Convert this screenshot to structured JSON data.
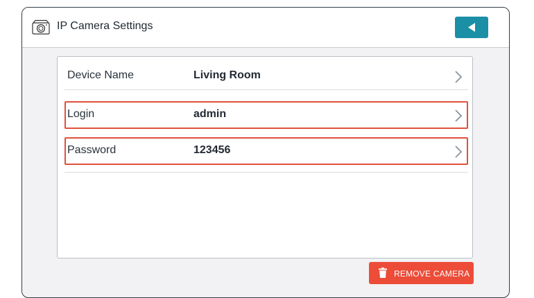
{
  "header": {
    "title": "IP Camera Settings",
    "camera_icon": "camera-icon",
    "back_icon": "back-arrow-icon",
    "accent_color": "#1a8fa6"
  },
  "settings": [
    {
      "label": "Device Name",
      "value": "Living Room",
      "highlighted": false
    },
    {
      "label": "Login",
      "value": "admin",
      "highlighted": true
    },
    {
      "label": "Password",
      "value": "123456",
      "highlighted": true
    }
  ],
  "remove_button": {
    "label": "REMOVE CAMERA",
    "icon": "trash-icon",
    "color": "#ec4c38"
  },
  "highlight_color": "#e0503a"
}
